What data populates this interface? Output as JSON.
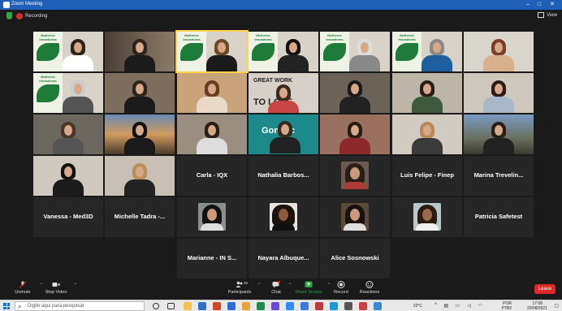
{
  "window": {
    "title": "Zoom Meeting",
    "minimize": "–",
    "maximize": "□",
    "close": "✕"
  },
  "meeting": {
    "recording_label": "Recording",
    "view_label": "View"
  },
  "participants": [
    {
      "name": "Carla - IQX"
    },
    {
      "name": "Nathalia Barbos..."
    },
    {
      "name": "Luis Felipe - Finep"
    },
    {
      "name": "Marina Trevelin..."
    },
    {
      "name": "Vanessa - Med3D"
    },
    {
      "name": "Michelle Tadra -..."
    },
    {
      "name": "Patricia Safetest"
    },
    {
      "name": "Marianne - IN S..."
    },
    {
      "name": "Nayara Albuque..."
    },
    {
      "name": "Alice Sosnowski"
    }
  ],
  "video_text": {
    "banner": "Mulheres Inovadoras",
    "sign1": "GREAT WORK",
    "sign2": "TO LOVE",
    "brand": "Gonetic"
  },
  "toolbar": {
    "unmute": "Unmute",
    "stop_video": "Stop Video",
    "participants": "Participants",
    "participants_count": "30",
    "chat": "Chat",
    "share_screen": "Share Screen",
    "record": "Record",
    "reactions": "Reactions",
    "leave": "Leave"
  },
  "taskbar": {
    "search_placeholder": "Digite aqui para pesquisar",
    "temperature": "22°C",
    "language": "POR",
    "language_sub": "PTB2",
    "time": "17:08",
    "date": "20/08/2021"
  },
  "colors": {
    "accent": "#1f5fb8",
    "leave": "#e02828",
    "share": "#2ea84a",
    "active_speaker": "#ffd34d"
  }
}
